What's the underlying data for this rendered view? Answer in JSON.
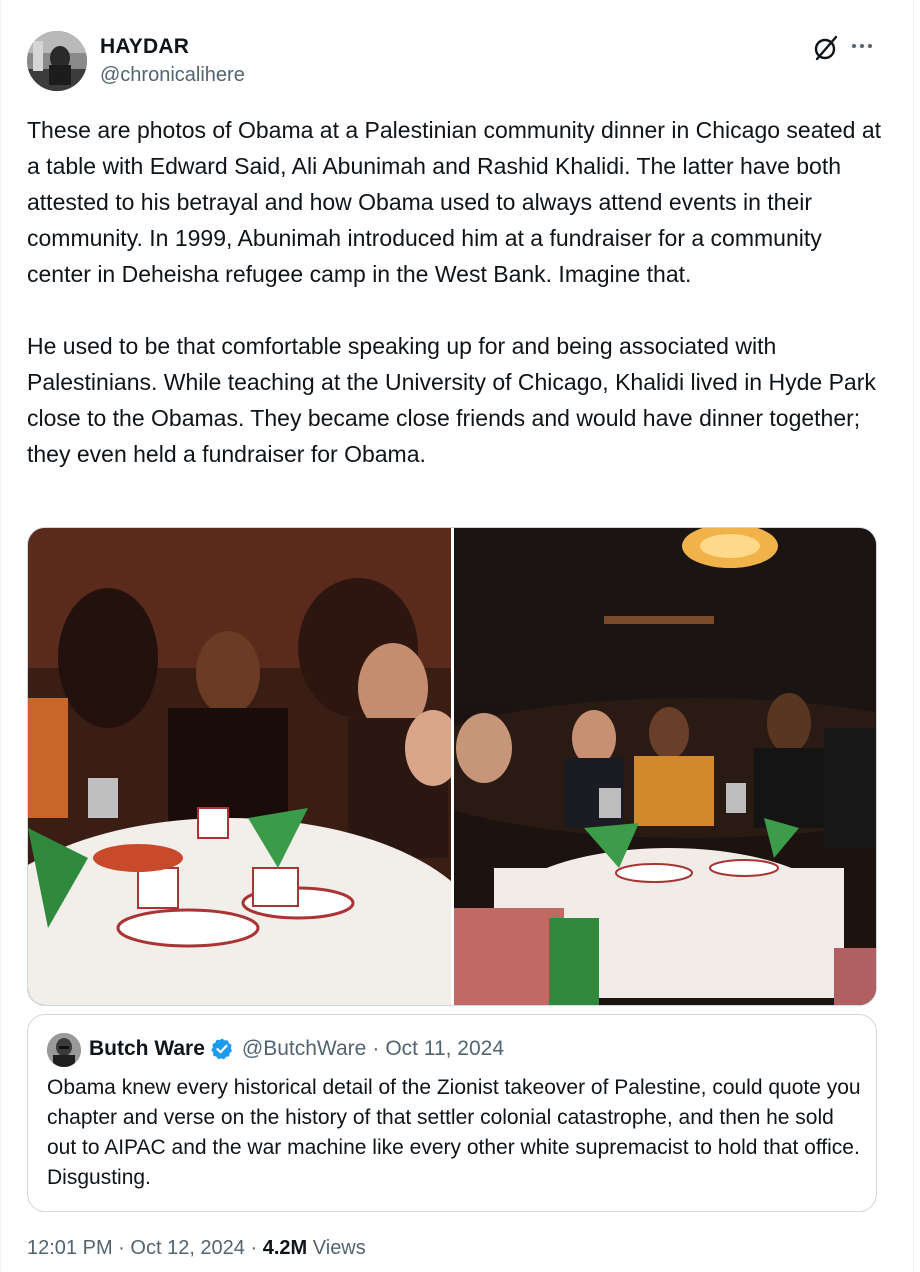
{
  "author": {
    "display_name": "HAYDAR",
    "handle": "@chronicalihere",
    "avatar_icon": "avatar-photo"
  },
  "header_actions": {
    "grok_icon": "grok-icon",
    "more_icon": "more-options-icon"
  },
  "tweet": {
    "paragraph_1": "These are photos of Obama at a Palestinian community dinner in Chicago seated at a table with Edward Said, Ali Abunimah and Rashid Khalidi. The latter have both attested to his betrayal and how Obama used to always attend events in their community. In 1999, Abunimah introduced him at a fundraiser for a community center in Deheisha refugee camp in the West Bank. Imagine that.",
    "paragraph_2": "He used to be that comfortable speaking up for and being associated with Palestinians. While teaching at the University of Chicago, Khalidi lived in Hyde Park close to the Obamas. They became close friends and would have dinner together; they even held a fundraiser for Obama."
  },
  "media": {
    "photo_count": 2
  },
  "quote": {
    "name": "Butch Ware",
    "handle": "@ButchWare",
    "separator": "·",
    "date": "Oct 11, 2024",
    "text": "Obama knew every historical detail of the Zionist takeover of Palestine, could quote you chapter and verse on the history of that settler colonial catastrophe, and then he sold out to AIPAC and the war machine like every other white supremacist to hold that office. Disgusting.",
    "verified_color": "#1d9bf0"
  },
  "meta": {
    "time": "12:01 PM",
    "separator": "·",
    "date": "Oct 12, 2024",
    "views_count": "4.2M",
    "views_label": "Views"
  },
  "colors": {
    "primary_text": "#0f1419",
    "secondary_text": "#536471",
    "border": "#cfd9de"
  }
}
